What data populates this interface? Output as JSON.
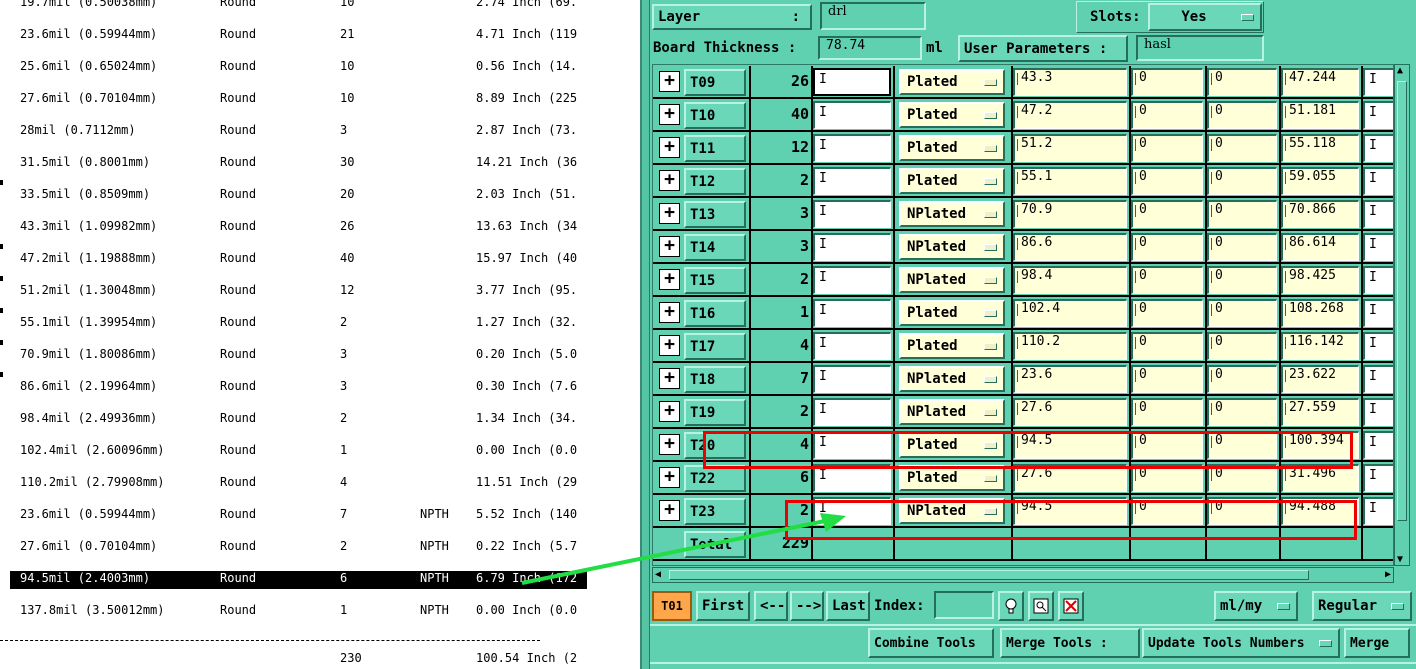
{
  "report": {
    "rows": [
      {
        "size": "19.7mil (0.50038mm)",
        "shape": "Round",
        "count": "10",
        "type": "",
        "length": "2.74 Inch (69."
      },
      {
        "size": "23.6mil (0.59944mm)",
        "shape": "Round",
        "count": "21",
        "type": "",
        "length": "4.71 Inch (119"
      },
      {
        "size": "25.6mil (0.65024mm)",
        "shape": "Round",
        "count": "10",
        "type": "",
        "length": "0.56 Inch (14."
      },
      {
        "size": "27.6mil (0.70104mm)",
        "shape": "Round",
        "count": "10",
        "type": "",
        "length": "8.89 Inch (225"
      },
      {
        "size": "28mil (0.7112mm)",
        "shape": "Round",
        "count": "3",
        "type": "",
        "length": "2.87 Inch (73."
      },
      {
        "size": "31.5mil (0.8001mm)",
        "shape": "Round",
        "count": "30",
        "type": "",
        "length": "14.21 Inch (36"
      },
      {
        "size": "33.5mil (0.8509mm)",
        "shape": "Round",
        "count": "20",
        "type": "",
        "length": "2.03 Inch (51."
      },
      {
        "size": "43.3mil (1.09982mm)",
        "shape": "Round",
        "count": "26",
        "type": "",
        "length": "13.63 Inch (34"
      },
      {
        "size": "47.2mil (1.19888mm)",
        "shape": "Round",
        "count": "40",
        "type": "",
        "length": "15.97 Inch (40"
      },
      {
        "size": "51.2mil (1.30048mm)",
        "shape": "Round",
        "count": "12",
        "type": "",
        "length": "3.77 Inch (95."
      },
      {
        "size": "55.1mil (1.39954mm)",
        "shape": "Round",
        "count": "2",
        "type": "",
        "length": "1.27 Inch (32."
      },
      {
        "size": "70.9mil (1.80086mm)",
        "shape": "Round",
        "count": "3",
        "type": "",
        "length": "0.20 Inch (5.0"
      },
      {
        "size": "86.6mil (2.19964mm)",
        "shape": "Round",
        "count": "3",
        "type": "",
        "length": "0.30 Inch (7.6"
      },
      {
        "size": "98.4mil (2.49936mm)",
        "shape": "Round",
        "count": "2",
        "type": "",
        "length": "1.34 Inch (34."
      },
      {
        "size": "102.4mil (2.60096mm)",
        "shape": "Round",
        "count": "1",
        "type": "",
        "length": "0.00 Inch (0.0"
      },
      {
        "size": "110.2mil (2.79908mm)",
        "shape": "Round",
        "count": "4",
        "type": "",
        "length": "11.51 Inch (29"
      },
      {
        "size": "23.6mil (0.59944mm)",
        "shape": "Round",
        "count": "7",
        "type": "NPTH",
        "length": "5.52 Inch (140"
      },
      {
        "size": "27.6mil (0.70104mm)",
        "shape": "Round",
        "count": "2",
        "type": "NPTH",
        "length": "0.22 Inch (5.7"
      },
      {
        "size": "94.5mil (2.4003mm)",
        "shape": "Round",
        "count": "6",
        "type": "NPTH",
        "length": "6.79 Inch (172"
      },
      {
        "size": "137.8mil (3.50012mm)",
        "shape": "Round",
        "count": "1",
        "type": "NPTH",
        "length": "0.00 Inch (0.0"
      }
    ],
    "total_count": "230",
    "total_length": "100.54 Inch (2"
  },
  "header": {
    "layer_label": "Layer",
    "layer_value": "drl",
    "slots_label": "Slots:",
    "slots_value": "Yes",
    "thickness_label": "Board Thickness :",
    "thickness_value": "78.74",
    "thickness_unit": "ml",
    "user_params_label": "User Parameters :",
    "user_params_value": "hasl"
  },
  "tools": [
    {
      "name": "T09",
      "count": "26",
      "type": "Plated",
      "d1": "43.3",
      "d2": "0",
      "d3": "0",
      "d4": "47.244"
    },
    {
      "name": "T10",
      "count": "40",
      "type": "Plated",
      "d1": "47.2",
      "d2": "0",
      "d3": "0",
      "d4": "51.181"
    },
    {
      "name": "T11",
      "count": "12",
      "type": "Plated",
      "d1": "51.2",
      "d2": "0",
      "d3": "0",
      "d4": "55.118"
    },
    {
      "name": "T12",
      "count": "2",
      "type": "Plated",
      "d1": "55.1",
      "d2": "0",
      "d3": "0",
      "d4": "59.055"
    },
    {
      "name": "T13",
      "count": "3",
      "type": "NPlated",
      "d1": "70.9",
      "d2": "0",
      "d3": "0",
      "d4": "70.866"
    },
    {
      "name": "T14",
      "count": "3",
      "type": "NPlated",
      "d1": "86.6",
      "d2": "0",
      "d3": "0",
      "d4": "86.614"
    },
    {
      "name": "T15",
      "count": "2",
      "type": "NPlated",
      "d1": "98.4",
      "d2": "0",
      "d3": "0",
      "d4": "98.425"
    },
    {
      "name": "T16",
      "count": "1",
      "type": "Plated",
      "d1": "102.4",
      "d2": "0",
      "d3": "0",
      "d4": "108.268"
    },
    {
      "name": "T17",
      "count": "4",
      "type": "Plated",
      "d1": "110.2",
      "d2": "0",
      "d3": "0",
      "d4": "116.142"
    },
    {
      "name": "T18",
      "count": "7",
      "type": "NPlated",
      "d1": "23.6",
      "d2": "0",
      "d3": "0",
      "d4": "23.622"
    },
    {
      "name": "T19",
      "count": "2",
      "type": "NPlated",
      "d1": "27.6",
      "d2": "0",
      "d3": "0",
      "d4": "27.559"
    },
    {
      "name": "T20",
      "count": "4",
      "type": "Plated",
      "d1": "94.5",
      "d2": "0",
      "d3": "0",
      "d4": "100.394"
    },
    {
      "name": "T22",
      "count": "6",
      "type": "Plated",
      "d1": "27.6",
      "d2": "0",
      "d3": "0",
      "d4": "31.496"
    },
    {
      "name": "T23",
      "count": "2",
      "type": "NPlated",
      "d1": "94.5",
      "d2": "0",
      "d3": "0",
      "d4": "94.488"
    }
  ],
  "total": {
    "label": "Total",
    "count": "229"
  },
  "nav": {
    "current_tool": "T01",
    "first": "First",
    "prev": "<--",
    "next": "-->",
    "last": "Last",
    "index_label": "Index:",
    "index_value": "",
    "units": "ml/my",
    "mode": "Regular"
  },
  "actions": {
    "combine": "Combine Tools",
    "merge_label": "Merge Tools :",
    "update_numbers": "Update Tools Numbers",
    "merge": "Merge"
  },
  "colors": {
    "panel": "#5fd0b0",
    "current_tool_bg": "#ffa64a",
    "highlight_box": "#e00000",
    "arrow": "#22dd44"
  }
}
